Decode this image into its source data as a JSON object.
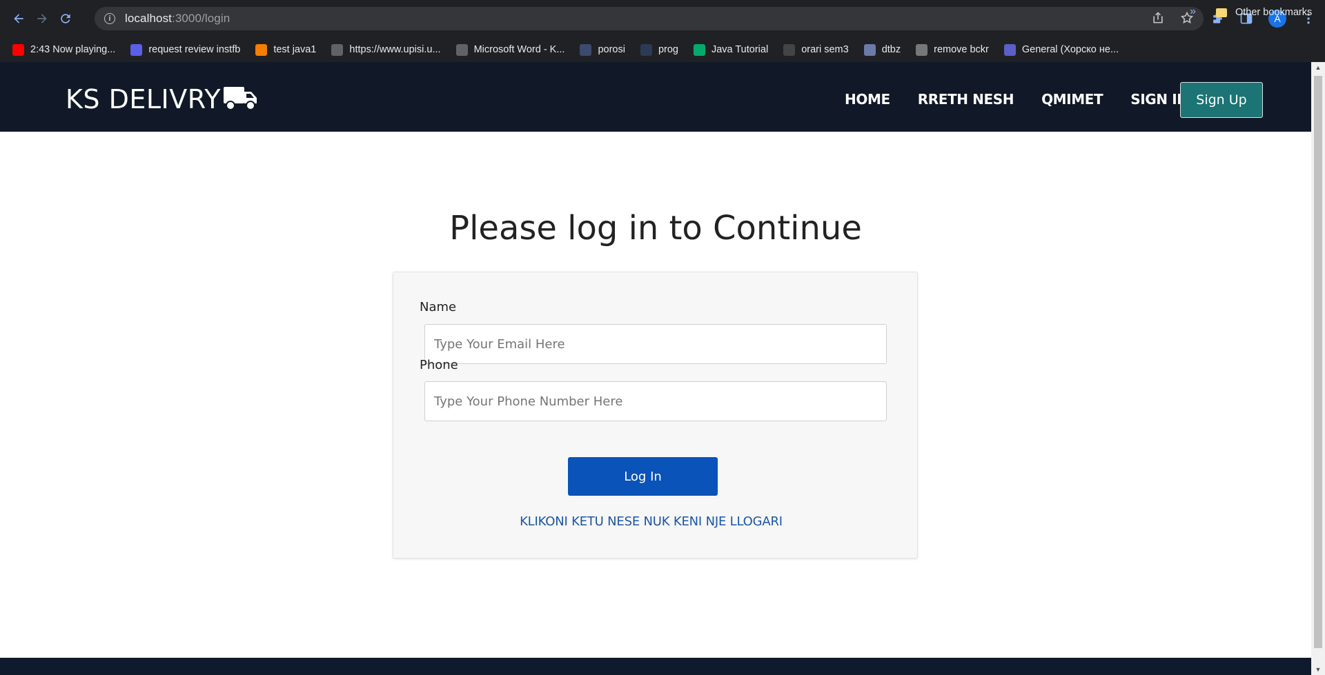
{
  "browser": {
    "url_host": "localhost",
    "url_path": ":3000/login",
    "avatar_letter": "A",
    "bookmarks": [
      {
        "label": "2:43 Now playing...",
        "icon": "youtube-icon",
        "color": "#ff0000"
      },
      {
        "label": "request review instfb",
        "icon": "app-icon",
        "color": "#5b5fe8"
      },
      {
        "label": "test java1",
        "icon": "blogger-icon",
        "color": "#f57d00"
      },
      {
        "label": "https://www.upisi.u...",
        "icon": "globe-icon",
        "color": "#5f6368"
      },
      {
        "label": "Microsoft Word - K...",
        "icon": "globe-icon",
        "color": "#5f6368"
      },
      {
        "label": "porosi",
        "icon": "page-icon",
        "color": "#3c4a6e"
      },
      {
        "label": "prog",
        "icon": "code-icon",
        "color": "#2b3b55"
      },
      {
        "label": "Java Tutorial",
        "icon": "w3-icon",
        "color": "#04aa6d"
      },
      {
        "label": "orari sem3",
        "icon": "cs-icon",
        "color": "#444"
      },
      {
        "label": "dtbz",
        "icon": "photo-icon",
        "color": "#6b7aa8"
      },
      {
        "label": "remove bckr",
        "icon": "layers-icon",
        "color": "#777"
      },
      {
        "label": "General (Хорско не...",
        "icon": "teams-icon",
        "color": "#5b5fc7"
      }
    ],
    "more_label": "»",
    "other_bookmarks": "Other bookmarks"
  },
  "navbar": {
    "brand": "KS DELIVRY",
    "links": [
      "HOME",
      "RRETH NESH",
      "QMIMET",
      "SIGN IN"
    ],
    "signup": "Sign Up"
  },
  "main": {
    "title": "Please log in to Continue",
    "name_label": "Name",
    "name_placeholder": "Type Your Email Here",
    "phone_label": "Phone",
    "phone_placeholder": "Type Your Phone Number Here",
    "login_button": "Log In",
    "signup_link": "KLIKONI KETU NESE NUK KENI NJE LLOGARI"
  },
  "colors": {
    "navbar_bg": "#111827",
    "signup_bg": "#1c7474",
    "login_bg": "#0a53b8",
    "link": "#1c55a8"
  }
}
